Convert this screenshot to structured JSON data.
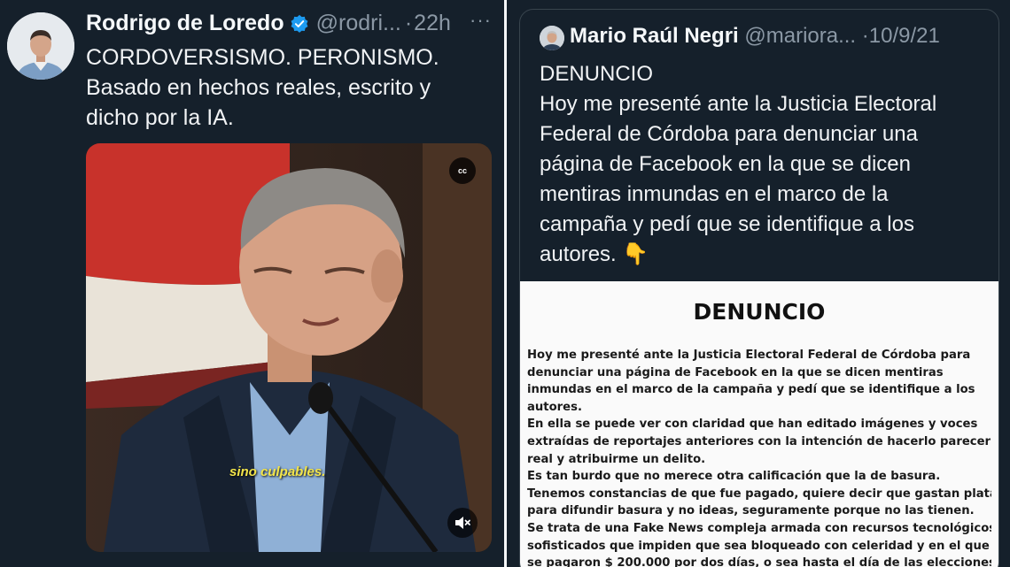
{
  "left_tweet": {
    "author_name": "Rodrigo de Loredo",
    "handle": "@rodri...",
    "separator": "·",
    "time": "22h",
    "more_label": "···",
    "text_lines": [
      "CORDOVERSISMO. PERONISMO.",
      "Basado en hechos reales, escrito y",
      "dicho por la IA."
    ],
    "video": {
      "subtitle": "sino culpables.",
      "cc_label": "cc"
    }
  },
  "quoted_tweet": {
    "author_name": "Mario Raúl Negri",
    "handle": "@mariora...",
    "separator": "·",
    "date": "10/9/21",
    "text_lines": [
      "DENUNCIO",
      "Hoy me presenté ante la Justicia Electoral",
      "Federal de Córdoba para denunciar una",
      "página de Facebook en la que se dicen",
      "mentiras inmundas en el marco de la",
      "campaña y pedí que se identifique a los",
      "autores. 👇"
    ],
    "document": {
      "title": "DENUNCIO",
      "lines": [
        "Hoy me presenté ante la Justicia Electoral Federal de Córdoba para",
        "denunciar una página de Facebook en la que se dicen mentiras",
        "inmundas en el marco de la campaña y pedí que se identifique a los",
        "autores.",
        "En ella se puede ver con claridad que han editado imágenes y voces",
        "extraídas de reportajes anteriores con la intención de hacerlo parecer",
        "real y atribuirme un delito.",
        "Es tan burdo que no merece otra calificación que la de basura.",
        "Tenemos constancias de que fue pagado, quiere decir que gastan plata",
        "para difundir basura y no ideas, seguramente porque no las tienen.",
        "Se trata de una Fake News compleja armada con recursos tecnológicos",
        "sofisticados que impiden que sea bloqueado con celeridad y en el que",
        "se pagaron $ 200.000 por dos días, o sea hasta el día de las elecciones."
      ]
    }
  },
  "colors": {
    "background": "#15202b",
    "verified": "#1d9bf0",
    "subtitle": "#f2e44a"
  }
}
